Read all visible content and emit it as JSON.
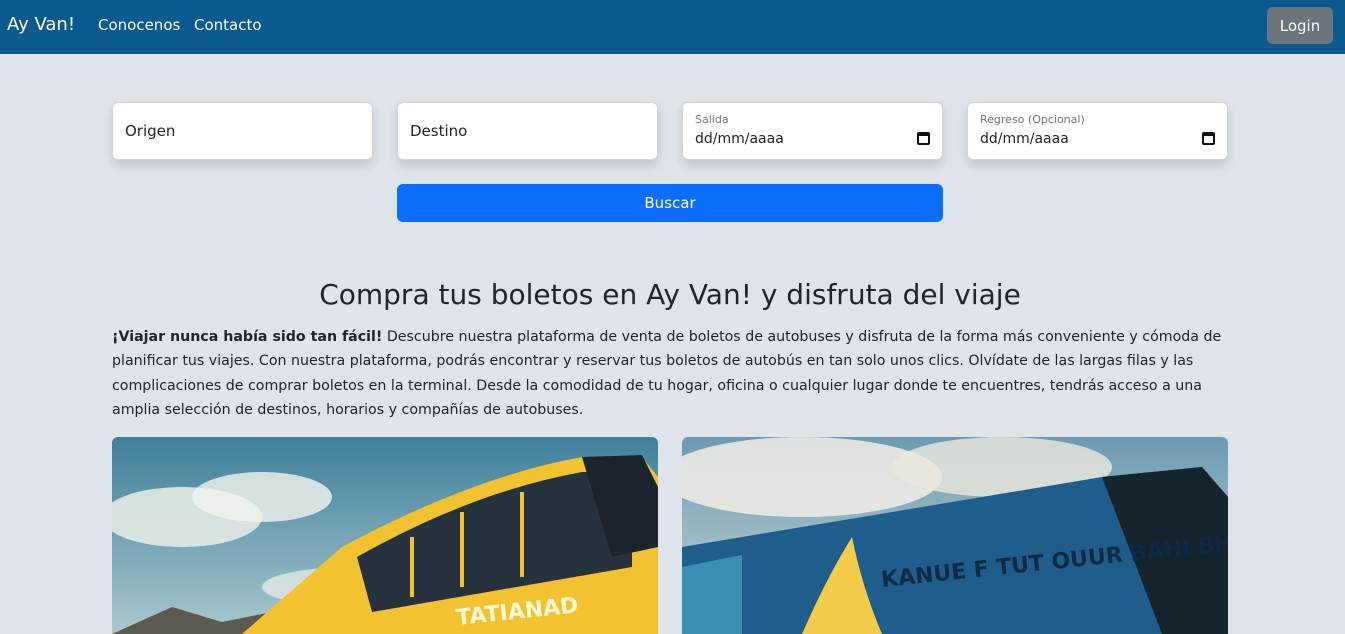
{
  "navbar": {
    "brand": "Ay Van!",
    "links": [
      "Conocenos",
      "Contacto"
    ],
    "login_label": "Login",
    "background": "#0a5a8f"
  },
  "search": {
    "origin_placeholder": "Origen",
    "destination_placeholder": "Destino",
    "departure_label": "Salida",
    "departure_value": "dd/mm/aaaa",
    "return_label": "Regreso (Opcional)",
    "return_value": "dd/mm/aaaa",
    "search_label": "Buscar",
    "button_color": "#0d6efd"
  },
  "hero": {
    "title": "Compra tus boletos en Ay Van! y disfruta del viaje",
    "lead_bold": "¡Viajar nunca había sido tan fácil!",
    "lead_text": " Descubre nuestra plataforma de venta de boletos de autobuses y disfruta de la forma más conveniente y cómoda de planificar tus viajes. Con nuestra plataforma, podrás encontrar y reservar tus boletos de autobús en tan solo unos clics. Olvídate de las largas filas y las complicaciones de comprar boletos en la terminal. Desde la comodidad de tu hogar, oficina o cualquier lugar donde te encuentres, tendrás acceso a una amplia selección de destinos, horarios y compañías de autobuses."
  },
  "gallery": {
    "images": [
      {
        "icon": "yellow-bus-image",
        "text": "TATIANAD"
      },
      {
        "icon": "blue-bus-image",
        "text": "KANUE F TUT OUUR BAHI BHAANUR"
      }
    ]
  }
}
